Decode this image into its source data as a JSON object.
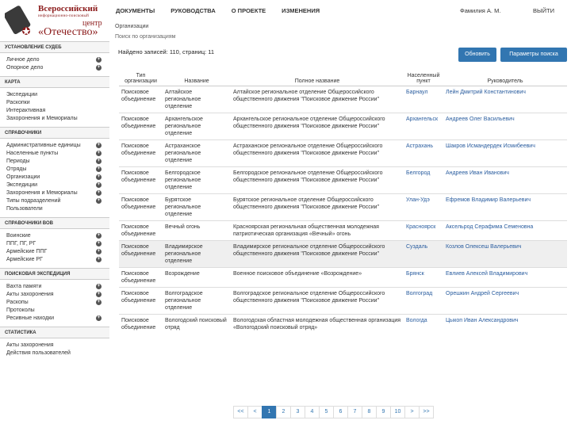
{
  "logo": {
    "line1": "Всероссийский",
    "line2": "информационно-поисковый",
    "line3": "центр",
    "line4": "«Отечество»"
  },
  "topnav": [
    "ДОКУМЕНТЫ",
    "РУКОВОДСТВА",
    "О ПРОЕКТЕ",
    "ИЗМЕНЕНИЯ"
  ],
  "user": "Фамилия А. М.",
  "exit": "ВЫЙТИ",
  "sidebar": {
    "sections": [
      {
        "title": "УСТАНОВЛЕНИЕ СУДЕБ",
        "items": [
          {
            "label": "Личное дело",
            "plus": true
          },
          {
            "label": "Опорное дело",
            "plus": true
          }
        ]
      },
      {
        "title": "КАРТА",
        "items": [
          {
            "label": "Экспедиции",
            "plus": false
          },
          {
            "label": "Раскопки",
            "plus": false
          },
          {
            "label": "Интерактивная",
            "plus": false
          },
          {
            "label": "Захоронения и Мемориалы",
            "plus": false
          }
        ]
      },
      {
        "title": "СПРАВОЧНИКИ",
        "items": [
          {
            "label": "Административные единицы",
            "plus": true
          },
          {
            "label": "Населенные пункты",
            "plus": true
          },
          {
            "label": "Периоды",
            "plus": true
          },
          {
            "label": "Отряды",
            "plus": true
          },
          {
            "label": "Организации",
            "plus": true
          },
          {
            "label": "Экспедиции",
            "plus": true
          },
          {
            "label": "Захоронения и Мемориалы",
            "plus": true
          },
          {
            "label": "Типы подразделений",
            "plus": true
          },
          {
            "label": "Пользователи",
            "plus": false
          }
        ]
      },
      {
        "title": "СПРАВОЧНИКИ ВОВ",
        "items": [
          {
            "label": "Воинские",
            "plus": true
          },
          {
            "label": "ППГ, ПГ, РГ",
            "plus": true
          },
          {
            "label": "Армейские ППГ",
            "plus": true
          },
          {
            "label": "Армейские РГ",
            "plus": true
          }
        ]
      },
      {
        "title": "ПОИСКОВАЯ ЭКСПЕДИЦИЯ",
        "items": [
          {
            "label": "Вахта памяти",
            "plus": true
          },
          {
            "label": "Акты захоронения",
            "plus": true
          },
          {
            "label": "Раскопы",
            "plus": true
          },
          {
            "label": "Протоколы",
            "plus": false
          },
          {
            "label": "Ресивные находки",
            "plus": true
          }
        ]
      },
      {
        "title": "СТАТИСТИКА",
        "items": [
          {
            "label": "Акты захоронения",
            "plus": false
          },
          {
            "label": "Действия пользователей",
            "plus": false
          }
        ]
      }
    ]
  },
  "main": {
    "crumb1": "Организации",
    "crumb2": "Поиск по организациям",
    "found": "Найдено записей: 110, страниц: 11",
    "refresh": "Обновить",
    "params": "Параметры поиска",
    "columns": [
      "Тип организации",
      "Название",
      "Полное название",
      "Населенный пункт",
      "Руководитель"
    ],
    "rows": [
      [
        "Поисковое объединение",
        "Алтайское региональное отделение",
        "Алтайское региональное отделение Общероссийского общественного движения \"Поисковое движение России\"",
        "Барнаул",
        "Лейн Дмитрий Константинович"
      ],
      [
        "Поисковое объединение",
        "Архангельское региональное отделение",
        "Архангельское региональное отделение Общероссийского общественного движения \"Поисковое движение России\"",
        "Архангельск",
        "Андреев Олег Васильевич"
      ],
      [
        "Поисковое объединение",
        "Астраханское региональное отделение",
        "Астраханское региональное отделение Общероссийского общественного движения \"Поисковое движение России\"",
        "Астрахань",
        "Шакров Исмандердек Исмибеевич"
      ],
      [
        "Поисковое объединение",
        "Белгородское региональное отделение",
        "Белгородское региональное отделение Общероссийского общественного движения \"Поисковое движение России\"",
        "Белгород",
        "Андреев Иван Иванович"
      ],
      [
        "Поисковое объединение",
        "Бурятское региональное отделение",
        "Бурятское региональное отделение Общероссийского общественного движения \"Поисковое движение России\"",
        "Улан-Удэ",
        "Ефремов Владимир Валерьевич"
      ],
      [
        "Поисковое объединение",
        "Вечный огонь",
        "Красноярская региональная общественная молодежная патриотическая организация «Вечный» огонь",
        "Красноярск",
        "Аксельрод Серафима Семеновна"
      ],
      [
        "Поисковое объединение",
        "Владимирское региональное отделение",
        "Владимирское региональное отделение Общероссийского общественного движения \"Поисковое движение России\"",
        "Суздаль",
        "Козлов Олексеш Валерьевич"
      ],
      [
        "Поисковое объединение",
        "Возрождение",
        "Военное поисковое объединение «Возрождение»",
        "Брянск",
        "Евлиев Алексей Владимирович"
      ],
      [
        "Поисковое объединение",
        "Волгоградское региональное отделение",
        "Волгоградское региональное отделение Общероссийского общественного движения \"Поисковое движение России\"",
        "Волгоград",
        "Орешкин Андрей Сергеевич"
      ],
      [
        "Поисковое объединение",
        "Вологодский поисковый отряд",
        "Вологодская областная молодежная общественная организация «Вологодский поисковый отряд»",
        "Вологда",
        "Цыкоп Иван Александрович"
      ]
    ]
  },
  "pagination": [
    "<<",
    "<",
    "1",
    "2",
    "3",
    "4",
    "5",
    "6",
    "7",
    "8",
    "9",
    "10",
    ">",
    ">>"
  ],
  "colors": {
    "accent": "#3276b1",
    "brand": "#8b1a1a"
  }
}
